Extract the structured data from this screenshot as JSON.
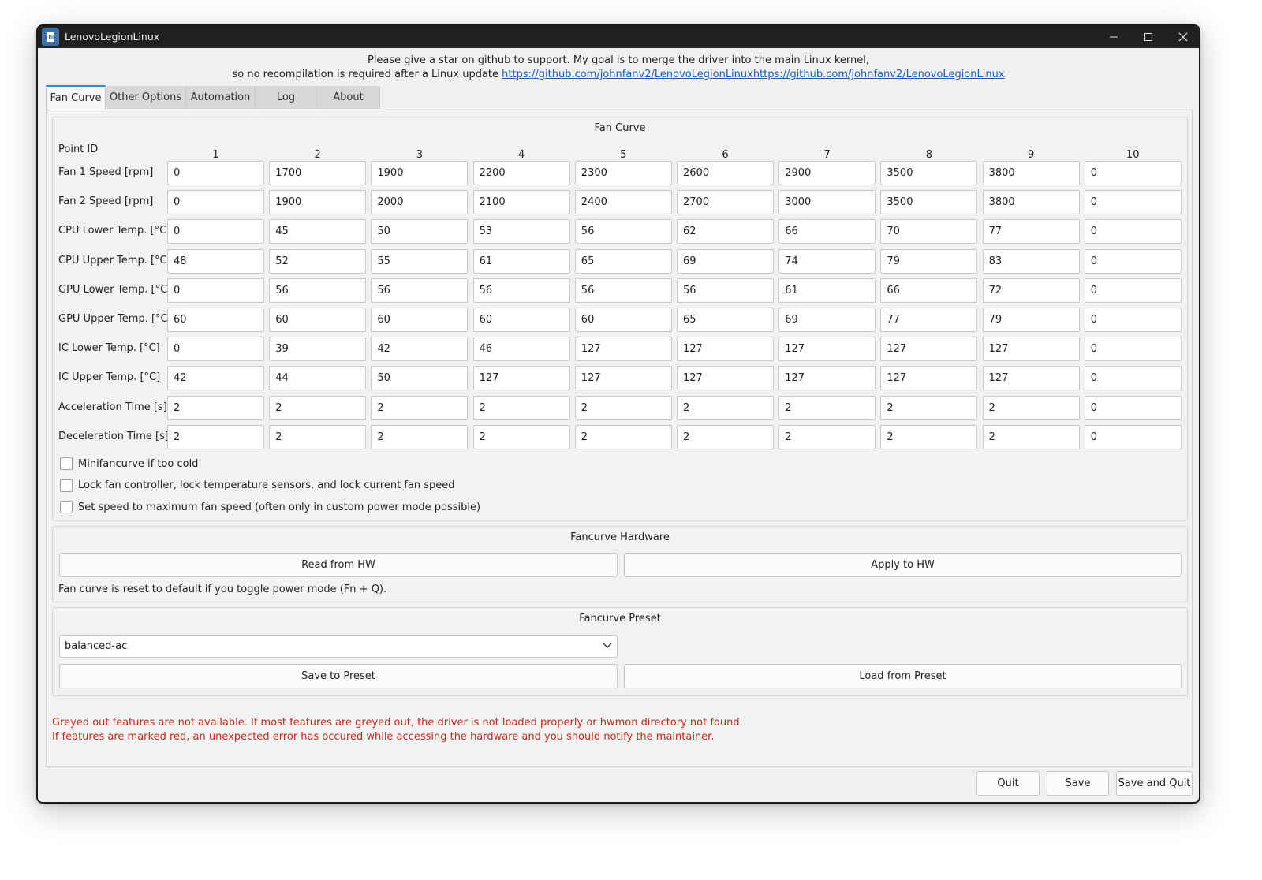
{
  "window": {
    "title": "LenovoLegionLinux"
  },
  "banner": {
    "line1": "Please give a star on github to support. My goal is to merge the driver into the main Linux kernel,",
    "line2_prefix": "so no recompilation is required after a Linux update ",
    "link": "https://github.com/johnfanv2/LenovoLegionLinuxhttps://github.com/johnfanv2/LenovoLegionLinux"
  },
  "tabs": [
    {
      "label": "Fan Curve",
      "active": true
    },
    {
      "label": "Other Options",
      "active": false
    },
    {
      "label": "Automation",
      "active": false
    },
    {
      "label": "Log",
      "active": false
    },
    {
      "label": "About",
      "active": false
    }
  ],
  "fan_curve": {
    "title": "Fan Curve",
    "point_id_label": "Point ID",
    "point_ids": [
      "1",
      "2",
      "3",
      "4",
      "5",
      "6",
      "7",
      "8",
      "9",
      "10"
    ],
    "rows": [
      {
        "label": "Fan 1 Speed [rpm]",
        "values": [
          "0",
          "1700",
          "1900",
          "2200",
          "2300",
          "2600",
          "2900",
          "3500",
          "3800",
          "0"
        ]
      },
      {
        "label": "Fan 2 Speed [rpm]",
        "values": [
          "0",
          "1900",
          "2000",
          "2100",
          "2400",
          "2700",
          "3000",
          "3500",
          "3800",
          "0"
        ]
      },
      {
        "label": "CPU Lower Temp. [°C]",
        "values": [
          "0",
          "45",
          "50",
          "53",
          "56",
          "62",
          "66",
          "70",
          "77",
          "0"
        ]
      },
      {
        "label": "CPU Upper Temp. [°C]",
        "values": [
          "48",
          "52",
          "55",
          "61",
          "65",
          "69",
          "74",
          "79",
          "83",
          "0"
        ]
      },
      {
        "label": "GPU Lower Temp. [°C]",
        "values": [
          "0",
          "56",
          "56",
          "56",
          "56",
          "56",
          "61",
          "66",
          "72",
          "0"
        ]
      },
      {
        "label": "GPU Upper Temp. [°C]",
        "values": [
          "60",
          "60",
          "60",
          "60",
          "60",
          "65",
          "69",
          "77",
          "79",
          "0"
        ]
      },
      {
        "label": "IC Lower Temp. [°C]",
        "values": [
          "0",
          "39",
          "42",
          "46",
          "127",
          "127",
          "127",
          "127",
          "127",
          "0"
        ]
      },
      {
        "label": "IC Upper Temp. [°C]",
        "values": [
          "42",
          "44",
          "50",
          "127",
          "127",
          "127",
          "127",
          "127",
          "127",
          "0"
        ]
      },
      {
        "label": "Acceleration  Time [s]",
        "values": [
          "2",
          "2",
          "2",
          "2",
          "2",
          "2",
          "2",
          "2",
          "2",
          "0"
        ]
      },
      {
        "label": "Deceleration Time [s]",
        "values": [
          "2",
          "2",
          "2",
          "2",
          "2",
          "2",
          "2",
          "2",
          "2",
          "0"
        ]
      }
    ],
    "checkboxes": [
      {
        "label": "Minifancurve if too cold",
        "checked": false
      },
      {
        "label": "Lock fan controller, lock temperature sensors, and lock current fan speed",
        "checked": false
      },
      {
        "label": "Set speed to maximum fan speed (often only in custom power mode possible)",
        "checked": false
      }
    ]
  },
  "hardware": {
    "title": "Fancurve Hardware",
    "read_label": "Read from HW",
    "apply_label": "Apply to HW",
    "note": "Fan curve is reset to default if you toggle power mode (Fn + Q)."
  },
  "preset": {
    "title": "Fancurve Preset",
    "selected": "balanced-ac",
    "save_label": "Save to Preset",
    "load_label": "Load from Preset"
  },
  "errors": {
    "line1": "Greyed out features are not available. If most features are greyed out, the driver is not loaded properly or hwmon directory not found.",
    "line2": "If features are marked red, an unexpected error has occured while accessing the hardware and you should notify the maintainer."
  },
  "footer": {
    "quit_label": "Quit",
    "save_label": "Save",
    "save_quit_label": "Save and Quit"
  },
  "colors": {
    "link": "#1a5fb4",
    "error": "#c0281d",
    "tab_accent": "#2a8ad4",
    "titlebar": "#202020"
  }
}
